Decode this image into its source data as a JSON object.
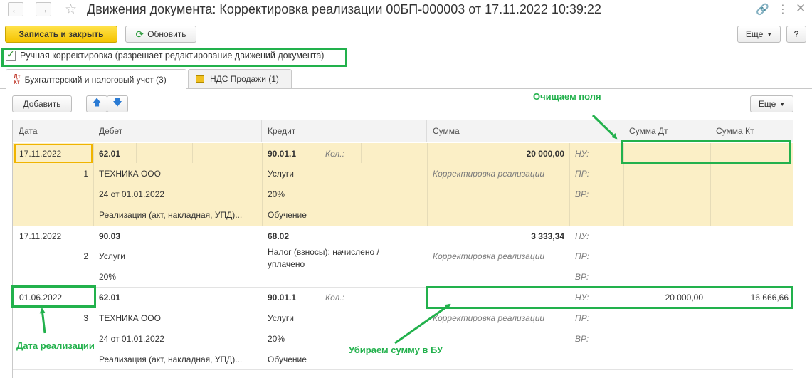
{
  "window": {
    "title": "Движения документа: Корректировка реализации 00БП-000003 от 17.11.2022 10:39:22"
  },
  "toolbar": {
    "save_close": "Записать и закрыть",
    "refresh": "Обновить",
    "more": "Еще",
    "help": "?"
  },
  "manual_edit": {
    "checked": true,
    "label": "Ручная корректировка (разрешает редактирование движений документа)"
  },
  "tabs": [
    {
      "label": "Бухгалтерский и налоговый учет (3)",
      "active": true,
      "icon": "dt-kt-icon"
    },
    {
      "label": "НДС Продажи (1)",
      "active": false,
      "icon": "register-icon"
    }
  ],
  "table_toolbar": {
    "add": "Добавить",
    "more": "Еще"
  },
  "columns": [
    "Дата",
    "Дебет",
    "Кредит",
    "Сумма",
    "",
    "Сумма Дт",
    "Сумма Кт"
  ],
  "rows": [
    {
      "date": "17.11.2022",
      "num": "1",
      "debit": [
        "62.01",
        "ТЕХНИКА ООО",
        "24 от 01.01.2022",
        "Реализация (акт, накладная, УПД)..."
      ],
      "credit": [
        "90.01.1",
        "Услуги",
        "20%",
        "Обучение"
      ],
      "kol": "Кол.:",
      "sum": "20 000,00",
      "content": "Корректировка реализации",
      "labels": [
        "НУ:",
        "ПР:",
        "ВР:"
      ],
      "sum_dt": "",
      "sum_kt": ""
    },
    {
      "date": "17.11.2022",
      "num": "2",
      "debit": [
        "90.03",
        "Услуги",
        "20%"
      ],
      "credit": [
        "68.02",
        "Налог (взносы): начислено /",
        "уплачено"
      ],
      "kol": "",
      "sum": "3 333,34",
      "content": "Корректировка реализации",
      "labels": [
        "НУ:",
        "ПР:",
        "ВР:"
      ],
      "sum_dt": "",
      "sum_kt": ""
    },
    {
      "date": "01.06.2022",
      "num": "3",
      "debit": [
        "62.01",
        "ТЕХНИКА ООО",
        "24 от 01.01.2022",
        "Реализация (акт, накладная, УПД)..."
      ],
      "credit": [
        "90.01.1",
        "Услуги",
        "20%",
        "Обучение"
      ],
      "kol": "Кол.:",
      "sum": "",
      "content": "Корректировка реализации",
      "labels": [
        "НУ:",
        "ПР:",
        "ВР:"
      ],
      "sum_dt": "20 000,00",
      "sum_kt": "16 666,66"
    }
  ],
  "annotations": {
    "clear_fields": "Очищаем поля",
    "remove_sum": "Убираем сумму в БУ",
    "sale_date": "Дата реализации"
  },
  "colors": {
    "accent_yellow": "#f5c300",
    "selection": "#fbefc6",
    "annotation_green": "#22b14c"
  }
}
